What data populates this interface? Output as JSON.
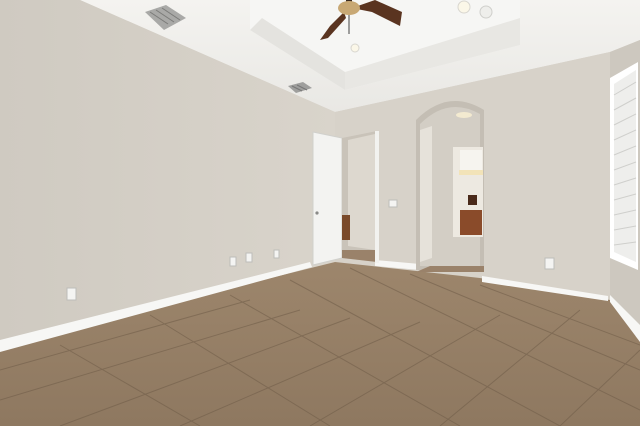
{
  "scene": {
    "kind": "photo",
    "subject": "empty-room-interior",
    "colors": {
      "wall": "#d6d1c8",
      "wall_shadow": "#c7c1b7",
      "ceiling": "#f2f1ee",
      "baseboard": "#f7f7f5",
      "tile": "#a38b71",
      "tile_dark": "#8a7259",
      "grout": "#6f5c48",
      "door": "#f3f3f1",
      "window_blind": "#f0f0ee",
      "fan_blade": "#5a3420",
      "cabinet": "#8a4b2a"
    },
    "icons": [
      "ceiling-fan-icon",
      "air-vent-icon",
      "power-outlet-icon",
      "light-switch-icon",
      "recessed-light-icon",
      "smoke-detector-icon"
    ]
  }
}
